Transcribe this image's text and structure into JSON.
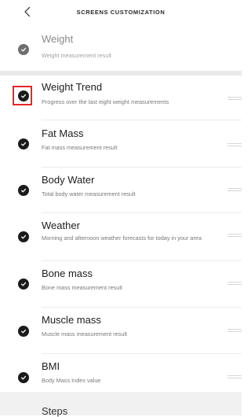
{
  "header": {
    "title": "SCREENS CUSTOMIZATION",
    "back_icon": "chevron-left-icon"
  },
  "top_item": {
    "title": "Weight",
    "subtitle": "Weight measurement result",
    "checked": true
  },
  "items": [
    {
      "title": "Weight Trend",
      "subtitle": "Progress over the last eight weight measurements",
      "checked": true,
      "highlighted": true
    },
    {
      "title": "Fat Mass",
      "subtitle": "Fat mass measurement result",
      "checked": true
    },
    {
      "title": "Body Water",
      "subtitle": "Total body water measurement result",
      "checked": true
    },
    {
      "title": "Weather",
      "subtitle": "Morning and afternoon weather forecasts for today in your area",
      "checked": true
    },
    {
      "title": "Bone mass",
      "subtitle": "Bone mass measurement result",
      "checked": true
    },
    {
      "title": "Muscle mass",
      "subtitle": "Muscle mass measurement result",
      "checked": true
    },
    {
      "title": "BMI",
      "subtitle": "Body Mass Index value",
      "checked": true
    }
  ],
  "bottom_item": {
    "title": "Steps"
  },
  "colors": {
    "check": "#1b1b1b",
    "check_grey": "#6e6e6e",
    "highlight": "#e3262b",
    "separator": "#e9e9ea"
  }
}
